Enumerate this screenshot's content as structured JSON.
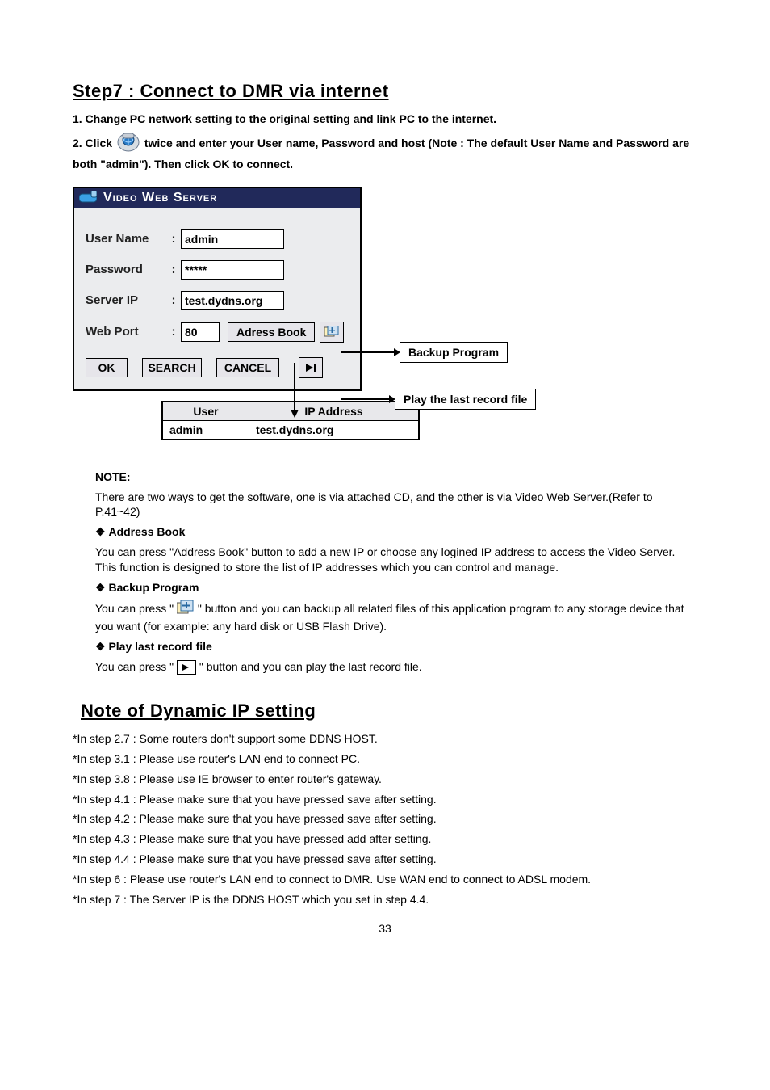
{
  "step7": {
    "title": "Step7 : Connect to DMR via internet",
    "line1": "1. Change PC network setting to the original setting and link PC to the internet.",
    "line2a": "2. Click ",
    "line2b": " twice and enter your User name, Password and host (Note : The default User Name and Password are both \"admin\"). Then click OK to connect."
  },
  "login": {
    "window_title": "Video Web Server",
    "labels": {
      "username": "User Name",
      "password": "Password",
      "serverip": "Server IP",
      "webport": "Web Port"
    },
    "values": {
      "username": "admin",
      "password": "*****",
      "serverip": "test.dydns.org",
      "webport": "80"
    },
    "buttons": {
      "ok": "OK",
      "search": "SEARCH",
      "cancel": "CANCEL",
      "adressbook": "Adress Book"
    }
  },
  "callouts": {
    "backup": "Backup Program",
    "play": "Play the last record file"
  },
  "addr_table": {
    "headers": [
      "User",
      "IP Address"
    ],
    "row": [
      "admin",
      "test.dydns.org"
    ]
  },
  "note": {
    "heading": "NOTE:",
    "body": "There are two ways to get the software,  one is  via attached CD, and the other is via Video Web Server.(Refer to P.41~42)"
  },
  "sections": {
    "addressbook": {
      "title": "Address Book",
      "body": "You can press \"Address Book\"  button to add a new IP or choose any logined IP address to access the Video Server. This function is designed to store  the list of IP addresses which you can control and manage."
    },
    "backup": {
      "title": "Backup Program",
      "pre": "You can press \" ",
      "post": " \" button and you can backup all related files of this application program to any storage device that you want (for example: any hard disk or USB Flash Drive)."
    },
    "play": {
      "title": "Play last record file",
      "pre": "You can press \" ",
      "post": " \" button and you can play the last record file."
    }
  },
  "dyn": {
    "title": "Note of Dynamic IP setting",
    "lines": [
      "*In step 2.7 : Some routers don't support some DDNS HOST.",
      "*In step 3.1 : Please use router's LAN end to connect PC.",
      "*In step 3.8 : Please use IE browser to enter router's gateway.",
      "*In step 4.1 : Please make sure that you have pressed save after setting.",
      "*In step 4.2 : Please make sure that you have pressed save after setting.",
      "*In step 4.3 : Please make sure that you have pressed add after setting.",
      "*In step 4.4 : Please make sure that you have pressed save after setting.",
      "*In step 6 : Please use router's LAN end to connect to DMR. Use WAN end to connect to ADSL modem.",
      "*In step 7 : The Server IP is the DDNS HOST which you set in step 4.4."
    ]
  },
  "page_number": "33"
}
